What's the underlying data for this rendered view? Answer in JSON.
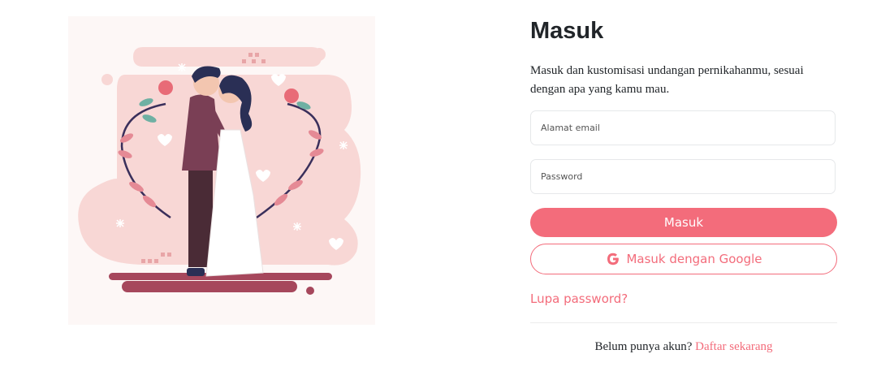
{
  "illustration": {
    "name": "wedding-couple-illustration"
  },
  "login": {
    "title": "Masuk",
    "subtitle": "Masuk dan kustomisasi undangan pernikahanmu, sesuai dengan apa yang kamu mau.",
    "email_placeholder": "Alamat email",
    "password_placeholder": "Password",
    "submit_label": "Masuk",
    "google_label": "Masuk dengan Google",
    "google_icon": "google-icon",
    "forgot_label": "Lupa password?",
    "signup_prompt": "Belum punya akun?",
    "signup_link": "Daftar sekarang"
  },
  "colors": {
    "accent": "#f36c7b",
    "illustration_bg": "#fdf7f6",
    "blob": "#f8d7d5",
    "ground": "#a6475c"
  }
}
